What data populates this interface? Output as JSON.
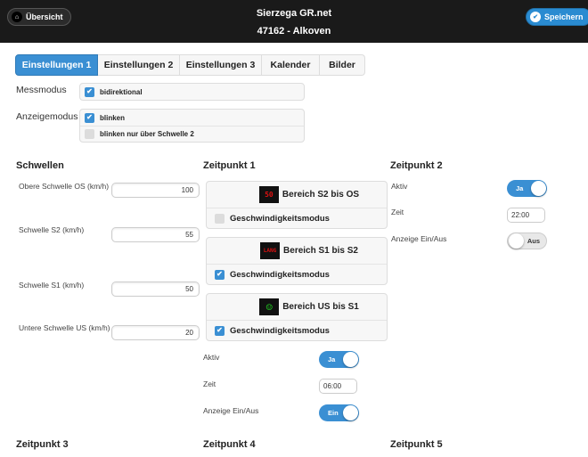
{
  "header": {
    "back_label": "Übersicht",
    "save_label": "Speichern",
    "title": "Sierzega GR.net",
    "subtitle": "47162 - Alkoven",
    "back_icon": "home-icon",
    "save_icon": "check-icon"
  },
  "tabs": [
    {
      "label": "Einstellungen 1",
      "active": true
    },
    {
      "label": "Einstellungen 2",
      "active": false
    },
    {
      "label": "Einstellungen 3",
      "active": false
    },
    {
      "label": "Kalender",
      "active": false
    },
    {
      "label": "Bilder",
      "active": false
    }
  ],
  "messmodus": {
    "label": "Messmodus",
    "options": [
      {
        "label": "bidirektional",
        "checked": true
      }
    ]
  },
  "anzeigemodus": {
    "label": "Anzeigemodus",
    "options": [
      {
        "label": "blinken",
        "checked": true
      },
      {
        "label": "blinken nur über Schwelle 2",
        "checked": false
      }
    ]
  },
  "schwellen": {
    "title": "Schwellen",
    "fields": [
      {
        "label": "Obere Schwelle OS (km/h)",
        "value": "100"
      },
      {
        "label": "Schwelle S2 (km/h)",
        "value": "55"
      },
      {
        "label": "Schwelle S1 (km/h)",
        "value": "50"
      },
      {
        "label": "Untere Schwelle US (km/h)",
        "value": "20"
      }
    ]
  },
  "zeitpunkt1": {
    "title": "Zeitpunkt 1",
    "ranges": [
      {
        "label": "Bereich S2 bis OS",
        "sign_text": "50",
        "sign_color": "#dd1111",
        "mode_label": "Geschwindigkeitsmodus",
        "checked": false
      },
      {
        "label": "Bereich S1 bis S2",
        "sign_text": "LANG",
        "sign_color": "#dd1111",
        "mode_label": "Geschwindigkeitsmodus",
        "checked": true
      },
      {
        "label": "Bereich US bis S1",
        "sign_text": "☺",
        "sign_color": "#22cc22",
        "mode_label": "Geschwindigkeitsmodus",
        "checked": true
      }
    ],
    "aktiv_label": "Aktiv",
    "aktiv_value": "Ja",
    "zeit_label": "Zeit",
    "zeit_value": "06:00",
    "anzeige_label": "Anzeige Ein/Aus",
    "anzeige_value": "Ein"
  },
  "zeitpunkt2": {
    "title": "Zeitpunkt 2",
    "aktiv_label": "Aktiv",
    "aktiv_value": "Ja",
    "zeit_label": "Zeit",
    "zeit_value": "22:00",
    "anzeige_label": "Anzeige Ein/Aus",
    "anzeige_value": "Aus"
  },
  "footer_sections": [
    "Zeitpunkt 3",
    "Zeitpunkt 4",
    "Zeitpunkt 5"
  ],
  "colors": {
    "accent": "#3a8fd3",
    "header_bg": "#1a1a1a",
    "sign_red": "#dd1111",
    "sign_green": "#22cc22"
  }
}
